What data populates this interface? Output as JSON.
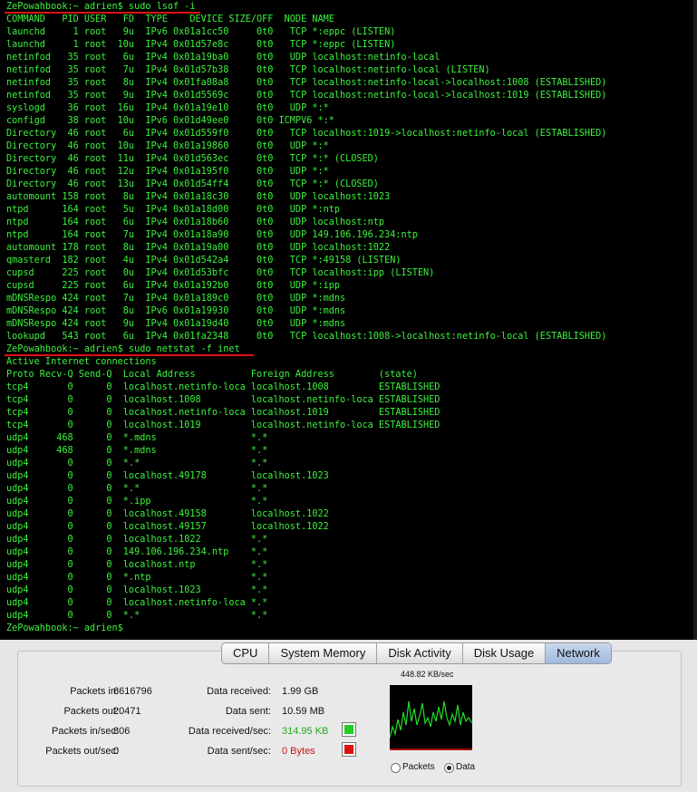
{
  "terminal": {
    "lines": [
      "ZePowahbook:~ adrien$ sudo lsof -i",
      "COMMAND   PID USER   FD  TYPE    DEVICE SIZE/OFF  NODE NAME",
      "launchd     1 root   9u  IPv6 0x01a1cc50     0t0   TCP *:eppc (LISTEN)",
      "launchd     1 root  10u  IPv4 0x01d57e8c     0t0   TCP *:eppc (LISTEN)",
      "netinfod   35 root   6u  IPv4 0x01a19ba0     0t0   UDP localhost:netinfo-local",
      "netinfod   35 root   7u  IPv4 0x01d57b38     0t0   TCP localhost:netinfo-local (LISTEN)",
      "netinfod   35 root   8u  IPv4 0x01fa08a8     0t0   TCP localhost:netinfo-local->localhost:1008 (ESTABLISHED)",
      "netinfod   35 root   9u  IPv4 0x01d5569c     0t0   TCP localhost:netinfo-local->localhost:1019 (ESTABLISHED)",
      "syslogd    36 root  16u  IPv4 0x01a19e10     0t0   UDP *:*",
      "configd    38 root  10u  IPv6 0x01d49ee0     0t0 ICMPV6 *:*",
      "Directory  46 root   6u  IPv4 0x01d559f0     0t0   TCP localhost:1019->localhost:netinfo-local (ESTABLISHED)",
      "Directory  46 root  10u  IPv4 0x01a19860     0t0   UDP *:*",
      "Directory  46 root  11u  IPv4 0x01d563ec     0t0   TCP *:* (CLOSED)",
      "Directory  46 root  12u  IPv4 0x01a195f0     0t0   UDP *:*",
      "Directory  46 root  13u  IPv4 0x01d54ff4     0t0   TCP *:* (CLOSED)",
      "automount 158 root   8u  IPv4 0x01a18c30     0t0   UDP localhost:1023",
      "ntpd      164 root   5u  IPv4 0x01a18d00     0t0   UDP *:ntp",
      "ntpd      164 root   6u  IPv4 0x01a18b60     0t0   UDP localhost:ntp",
      "ntpd      164 root   7u  IPv4 0x01a18a90     0t0   UDP 149.106.196.234:ntp",
      "automount 178 root   8u  IPv4 0x01a19a00     0t0   UDP localhost:1022",
      "qmasterd  182 root   4u  IPv4 0x01d542a4     0t0   TCP *:49158 (LISTEN)",
      "cupsd     225 root   0u  IPv4 0x01d53bfc     0t0   TCP localhost:ipp (LISTEN)",
      "cupsd     225 root   6u  IPv4 0x01a192b0     0t0   UDP *:ipp",
      "mDNSRespo 424 root   7u  IPv4 0x01a189c0     0t0   UDP *:mdns",
      "mDNSRespo 424 root   8u  IPv6 0x01a19930     0t0   UDP *:mdns",
      "mDNSRespo 424 root   9u  IPv4 0x01a19d40     0t0   UDP *:mdns",
      "lookupd   543 root   6u  IPv4 0x01fa2348     0t0   TCP localhost:1008->localhost:netinfo-local (ESTABLISHED)",
      "ZePowahbook:~ adrien$ sudo netstat -f inet",
      "Active Internet connections",
      "Proto Recv-Q Send-Q  Local Address          Foreign Address        (state)",
      "tcp4       0      0  localhost.netinfo-loca localhost.1008         ESTABLISHED",
      "tcp4       0      0  localhost.1008         localhost.netinfo-loca ESTABLISHED",
      "tcp4       0      0  localhost.netinfo-loca localhost.1019         ESTABLISHED",
      "tcp4       0      0  localhost.1019         localhost.netinfo-loca ESTABLISHED",
      "udp4     468      0  *.mdns                 *.*",
      "udp4     468      0  *.mdns                 *.*",
      "udp4       0      0  *.*                    *.*",
      "udp4       0      0  localhost.49178        localhost.1023",
      "udp4       0      0  *.*                    *.*",
      "udp4       0      0  *.ipp                  *.*",
      "udp4       0      0  localhost.49158        localhost.1022",
      "udp4       0      0  localhost.49157        localhost.1022",
      "udp4       0      0  localhost.1022         *.*",
      "udp4       0      0  149.106.196.234.ntp    *.*",
      "udp4       0      0  localhost.ntp          *.*",
      "udp4       0      0  *.ntp                  *.*",
      "udp4       0      0  localhost.1023         *.*",
      "udp4       0      0  localhost.netinfo-loca *.*",
      "udp4       0      0  *.*                    *.*",
      "ZePowahbook:~ adrien$"
    ],
    "text_color": "#3cf23c",
    "underline_color": "#e01010"
  },
  "monitor": {
    "tabs": [
      {
        "label": "CPU"
      },
      {
        "label": "System Memory"
      },
      {
        "label": "Disk Activity"
      },
      {
        "label": "Disk Usage"
      },
      {
        "label": "Network"
      }
    ],
    "active_tab": "Network",
    "packets_in_label": "Packets in:",
    "packets_in": "6616796",
    "packets_out_label": "Packets out:",
    "packets_out": "20471",
    "packets_in_sec_label": "Packets in/sec:",
    "packets_in_sec": "806",
    "packets_out_sec_label": "Packets out/sec:",
    "packets_out_sec": "0",
    "data_received_label": "Data received:",
    "data_received": "1.99 GB",
    "data_sent_label": "Data sent:",
    "data_sent": "10.59 MB",
    "data_received_sec_label": "Data received/sec:",
    "data_received_sec": "314.95 KB",
    "data_sent_sec_label": "Data sent/sec:",
    "data_sent_sec": "0 Bytes",
    "received_color": "#22cc22",
    "sent_color": "#dd1111",
    "graph_max_label": "448.82 KB/sec",
    "radio_packets_label": "Packets",
    "radio_data_label": "Data",
    "selected_radio": "Data"
  }
}
